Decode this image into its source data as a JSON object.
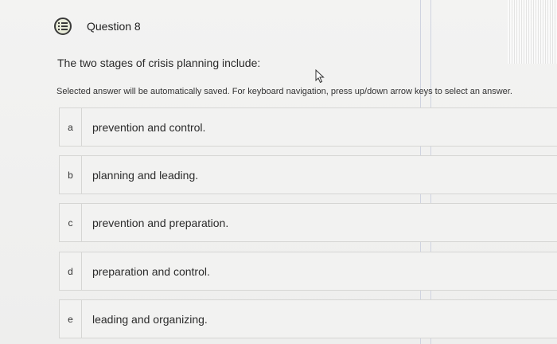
{
  "question": {
    "title": "Question 8",
    "prompt": "The two stages of crisis planning include:",
    "instructions": "Selected answer will be automatically saved. For keyboard navigation, press up/down arrow keys to select an answer."
  },
  "options": [
    {
      "letter": "a",
      "text": "prevention and control."
    },
    {
      "letter": "b",
      "text": "planning and leading."
    },
    {
      "letter": "c",
      "text": "prevention and preparation."
    },
    {
      "letter": "d",
      "text": "preparation and control."
    },
    {
      "letter": "e",
      "text": "leading and organizing."
    }
  ],
  "icons": {
    "question_status": "question-list-icon",
    "cursor": "mouse-pointer-icon"
  }
}
